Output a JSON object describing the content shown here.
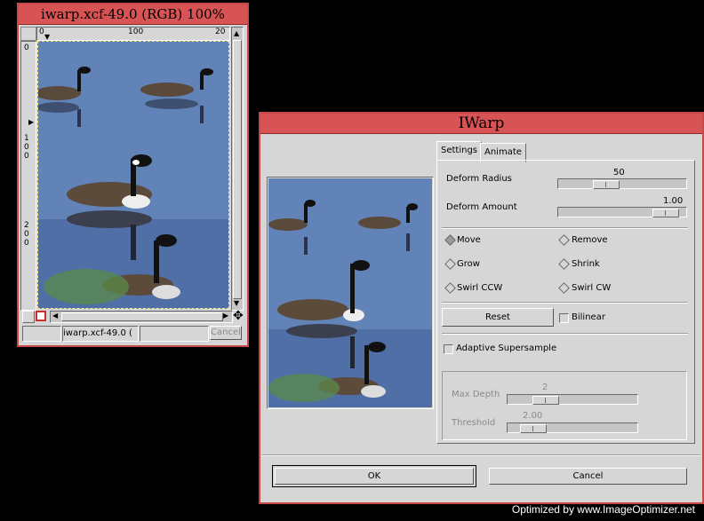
{
  "image_window": {
    "title": "iwarp.xcf-49.0 (RGB) 100%",
    "ruler_h": [
      "0",
      "100",
      "20"
    ],
    "ruler_v": [
      "0",
      "1",
      "0",
      "0",
      "2",
      "0",
      "0"
    ],
    "status_text": "iwarp.xcf-49.0 (",
    "cancel_label": "Cancel"
  },
  "dialog": {
    "title": "IWarp",
    "tabs": [
      "Settings",
      "Animate"
    ],
    "deform_radius": {
      "label": "Deform Radius",
      "value": "50",
      "fraction": 0.34
    },
    "deform_amount": {
      "label": "Deform Amount",
      "value": "1.00",
      "fraction": 0.93
    },
    "modes": [
      {
        "label": "Move",
        "selected": true
      },
      {
        "label": "Remove",
        "selected": false
      },
      {
        "label": "Grow",
        "selected": false
      },
      {
        "label": "Shrink",
        "selected": false
      },
      {
        "label": "Swirl CCW",
        "selected": false
      },
      {
        "label": "Swirl CW",
        "selected": false
      }
    ],
    "reset_label": "Reset",
    "bilinear_label": "Bilinear",
    "adaptive_label": "Adaptive Supersample",
    "max_depth": {
      "label": "Max Depth",
      "value": "2",
      "fraction": 0.24
    },
    "threshold": {
      "label": "Threshold",
      "value": "2.00",
      "fraction": 0.12
    },
    "ok_label": "OK",
    "cancel_label": "Cancel"
  },
  "footer": "Optimized by www.ImageOptimizer.net"
}
